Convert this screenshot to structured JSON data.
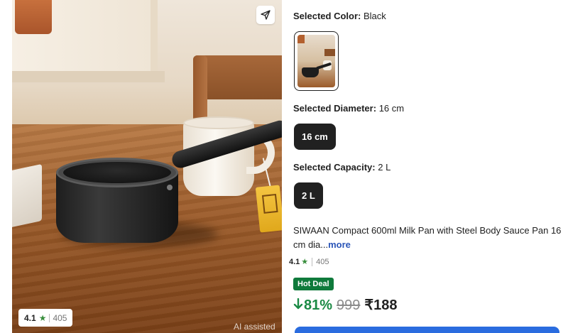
{
  "product_image": {
    "rating": "4.1",
    "rating_count": "405",
    "ai_badge": "AI assisted"
  },
  "options": {
    "color_label": "Selected Color:",
    "color_value": "Black",
    "diameter_label": "Selected Diameter:",
    "diameter_value": "16 cm",
    "diameter_chip": "16 cm",
    "capacity_label": "Selected Capacity:",
    "capacity_value": "2 L",
    "capacity_chip": "2 L"
  },
  "product": {
    "title": "SIWAAN Compact 600ml Milk Pan with Steel Body Sauce Pan 16 cm dia...",
    "more_link": "more",
    "rating": "4.1",
    "rating_count": "405",
    "badge": "Hot Deal",
    "discount": "81%",
    "mrp": "999",
    "price": "₹188"
  },
  "icons": {
    "share": "send-icon",
    "star": "star-icon",
    "discount_arrow": "arrow-down-icon"
  },
  "colors": {
    "accent_green": "#1b8a45",
    "hot_deal_bg": "#0f7a3b",
    "chip_bg": "#212121",
    "link_blue": "#2a55b8",
    "buy_button": "#2a6cdf"
  }
}
